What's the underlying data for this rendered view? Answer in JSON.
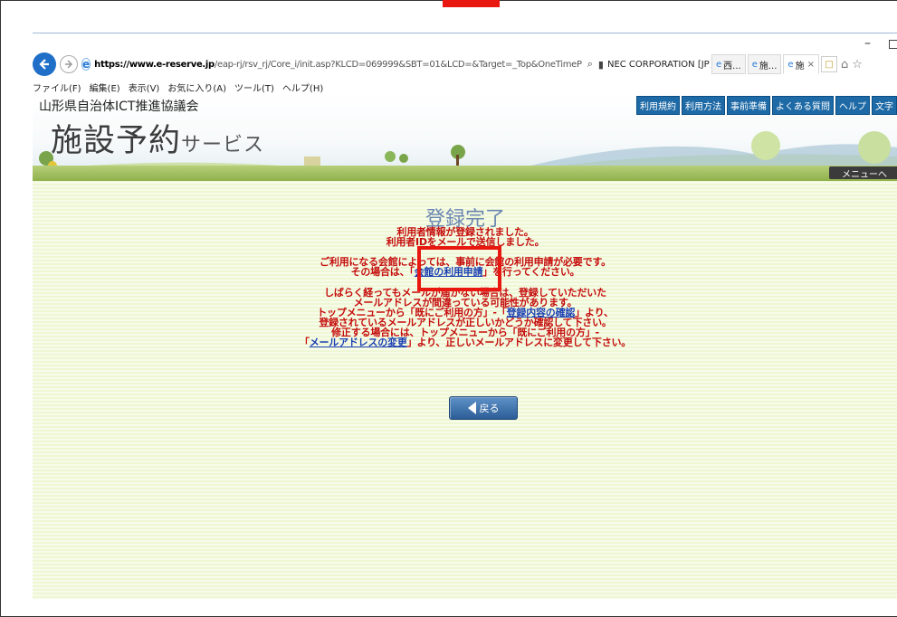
{
  "browser": {
    "url_host": "https://www.e-reserve.jp",
    "url_rest": "/eap-rj/rsv_rj/Core_i/init.asp?KLCD=069999&SBT=01&LCD=&Target=_Top&OneTimeP",
    "certificate": "NEC CORPORATION [JP]",
    "tabs": [
      {
        "label": "西..."
      },
      {
        "label": "施..."
      },
      {
        "label": "施"
      }
    ],
    "search_glyph": "⌕",
    "lock_glyph": "🔒",
    "refresh_glyph": "C",
    "menu": [
      "ファイル(F)",
      "編集(E)",
      "表示(V)",
      "お気に入り(A)",
      "ツール(T)",
      "ヘルプ(H)"
    ]
  },
  "header": {
    "org_name": "山形県自治体ICT推進協議会",
    "title_main": "施設予約",
    "title_sub": "サービス",
    "links": [
      "利用規約",
      "利用方法",
      "事前準備",
      "よくある質問",
      "ヘルプ",
      "文字"
    ],
    "menu_back": "メニューへ"
  },
  "content": {
    "title": "登録完了",
    "line1": "利用者情報が登録されました。",
    "line2": "利用者IDをメールで送信しました。",
    "line3": "ご利用になる会館によっては、事前に会館の利用申請が必要です。",
    "line4_pre": "その場合は、「",
    "line4_link": "会館の利用申請",
    "line4_post": "」を行ってください。",
    "line5": "しばらく経ってもメールが届かない場合は、登録していただいた",
    "line6": "メールアドレスが間違っている可能性があります。",
    "line7_pre": "トップメニューから「既にご利用の方」-「",
    "line7_link": "登録内容の確認",
    "line7_post": "」より、",
    "line8": "登録されているメールアドレスが正しいかどうか確認して下さい。",
    "line9": "修正する場合には、トップメニューから「既にご利用の方」-",
    "line10_pre": "「",
    "line10_link": "メールアドレスの変更",
    "line10_post": "」より、正しいメールアドレスに変更して下さい。",
    "back_label": "戻る"
  },
  "colors": {
    "annotation_red": "#e8170f",
    "message_red": "#c50d0d",
    "link_blue": "#1b3fb3",
    "title_blue": "#6b86b1"
  }
}
